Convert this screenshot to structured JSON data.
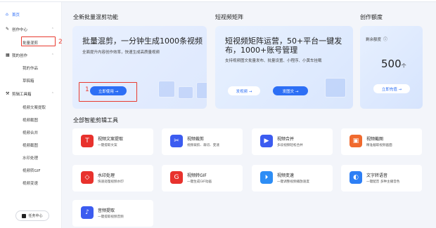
{
  "sidebar": {
    "home": "首页",
    "create_center": "创作中心",
    "batch_mix": "批量混剪",
    "my_creation": "我的创作",
    "my_works": "我的作品",
    "drafts": "草稿箱",
    "clip_toolbox": "剪辑工具箱",
    "tools": [
      "视频文案提取",
      "视频截图",
      "视频合并",
      "视频截图",
      "水印处理",
      "视频转GIF",
      "视频变速"
    ],
    "task_center": "任务中心"
  },
  "annotations": {
    "n1": "1",
    "n2": "2"
  },
  "sections": {
    "batch": "全新批量混剪功能",
    "matrix": "短视频矩阵",
    "quota": "创作额度",
    "tools": "全部智能剪辑工具"
  },
  "cards": {
    "batch": {
      "title": "批量混剪，一分钟生成1000条视频",
      "subtitle": "全面提升内容创作效率，快速生成高质量视频",
      "button": "立即使用 →"
    },
    "matrix": {
      "title": "短视频矩阵运营，50+平台一键发布，1000+账号管理",
      "subtitle": "支持视频图文批量发布、批量设置、小程序、小黄车挂载",
      "btn_video": "发视频 →",
      "btn_image": "发图文 →"
    },
    "quota": {
      "label": "剩余额度",
      "value": "500",
      "unit": "个",
      "button": "立即充值 →"
    }
  },
  "tools": [
    {
      "name": "视频文案提取",
      "desc": "一键提取文案",
      "color": "#e8322d",
      "icon": "T"
    },
    {
      "name": "视频裁剪",
      "desc": "视频裁剪、裁切、变速",
      "color": "#3c5cf0",
      "icon": "✂"
    },
    {
      "name": "视频合并",
      "desc": "多段视频轻松合并",
      "color": "#3c5cf0",
      "icon": "▶"
    },
    {
      "name": "视频截图",
      "desc": "精准截取视频画面",
      "color": "#f06a2e",
      "icon": "▣"
    },
    {
      "name": "水印处理",
      "desc": "快速处理视频水印",
      "color": "#e8322d",
      "icon": "◇"
    },
    {
      "name": "视频转GIF",
      "desc": "一键生成GIF动画",
      "color": "#e8322d",
      "icon": "G"
    },
    {
      "name": "视频变速",
      "desc": "一键调整视频播放速度",
      "color": "#2d8df5",
      "icon": "⏵"
    },
    {
      "name": "文字转语音",
      "desc": "一键配音 多种主播音色",
      "color": "#2d7ff5",
      "icon": "◐"
    },
    {
      "name": "音频提取",
      "desc": "一键提取视频音频",
      "color": "#3c5cf0",
      "icon": "♪"
    }
  ]
}
